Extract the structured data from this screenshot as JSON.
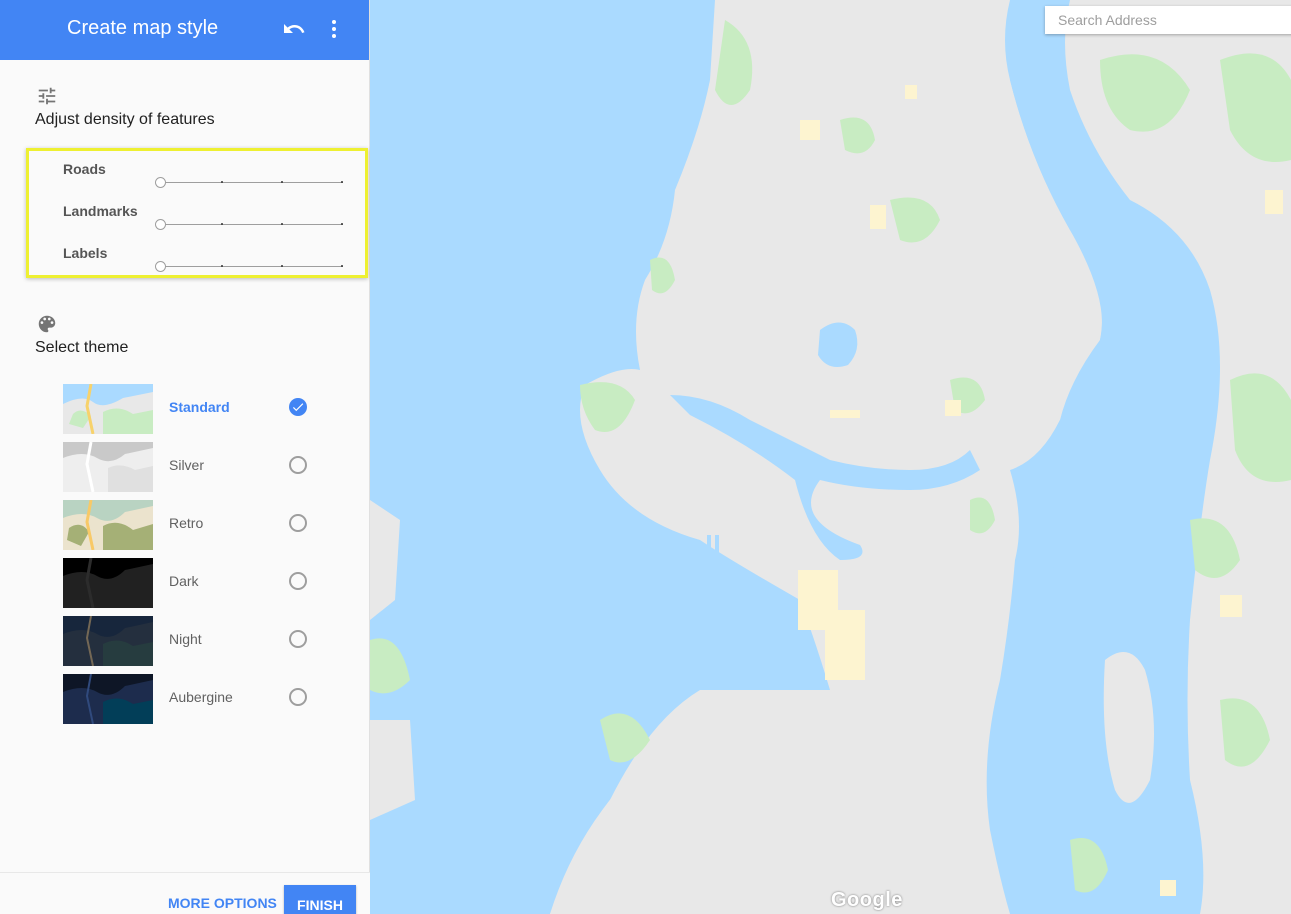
{
  "header": {
    "title": "Create map style"
  },
  "density": {
    "heading": "Adjust density of features",
    "sliders": [
      {
        "label": "Roads",
        "level": 0,
        "max": 3
      },
      {
        "label": "Landmarks",
        "level": 0,
        "max": 3
      },
      {
        "label": "Labels",
        "level": 0,
        "max": 3
      }
    ]
  },
  "theme": {
    "heading": "Select theme",
    "options": [
      {
        "label": "Standard",
        "selected": true
      },
      {
        "label": "Silver",
        "selected": false
      },
      {
        "label": "Retro",
        "selected": false
      },
      {
        "label": "Dark",
        "selected": false
      },
      {
        "label": "Night",
        "selected": false
      },
      {
        "label": "Aubergine",
        "selected": false
      }
    ]
  },
  "footer": {
    "more_options": "MORE OPTIONS",
    "finish": "FINISH"
  },
  "search": {
    "placeholder": "Search Address"
  },
  "map": {
    "logo": "Google"
  },
  "colors": {
    "accent": "#4285f4",
    "highlight": "#eef031",
    "water": "#aadaff",
    "land": "#e8e8e8",
    "park": "#c8ecc2"
  }
}
